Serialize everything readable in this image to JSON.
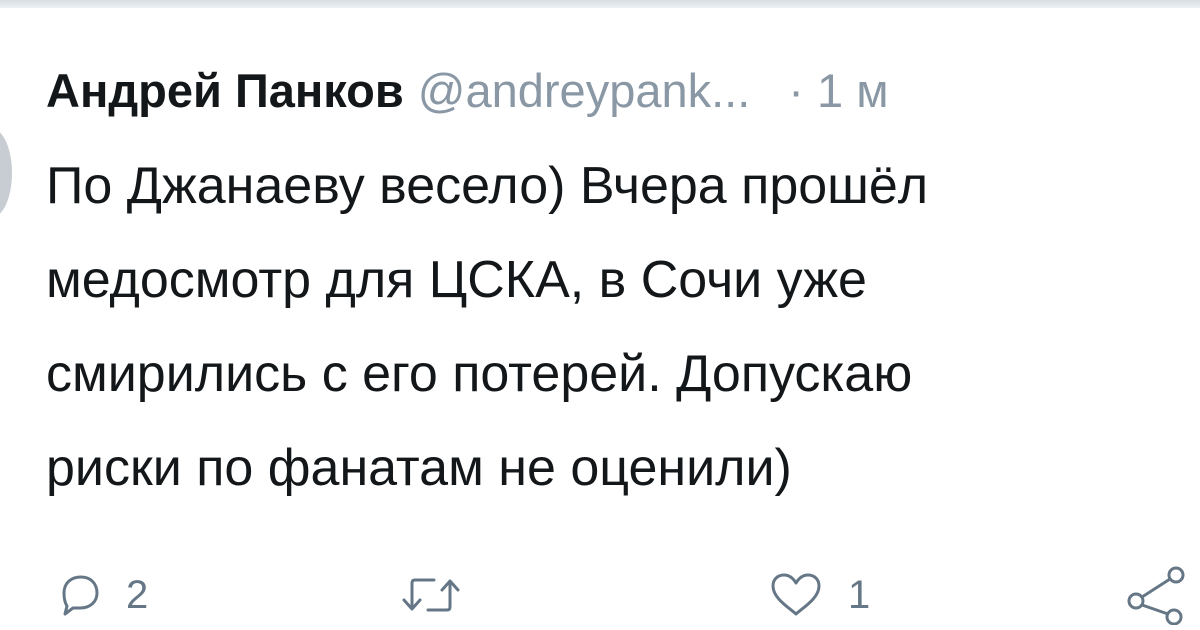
{
  "tweet": {
    "author_name": "Андрей Панков",
    "handle": "@andreypank...",
    "time": "· 1 м",
    "lines": [
      "По Джанаеву весело) Вчера прошёл",
      "медосмотр для ЦСКА, в Сочи уже",
      "смирились с его потерей. Допускаю",
      "риски по фанатам не оценили)"
    ]
  },
  "actions": {
    "reply": {
      "icon": "reply-icon",
      "count": "2"
    },
    "retweet": {
      "icon": "retweet-icon",
      "count": ""
    },
    "like": {
      "icon": "heart-icon",
      "count": "1"
    },
    "share": {
      "icon": "share-icon"
    }
  },
  "colors": {
    "text": "#14171a",
    "secondary": "#8a97a5",
    "icon": "#657786"
  }
}
